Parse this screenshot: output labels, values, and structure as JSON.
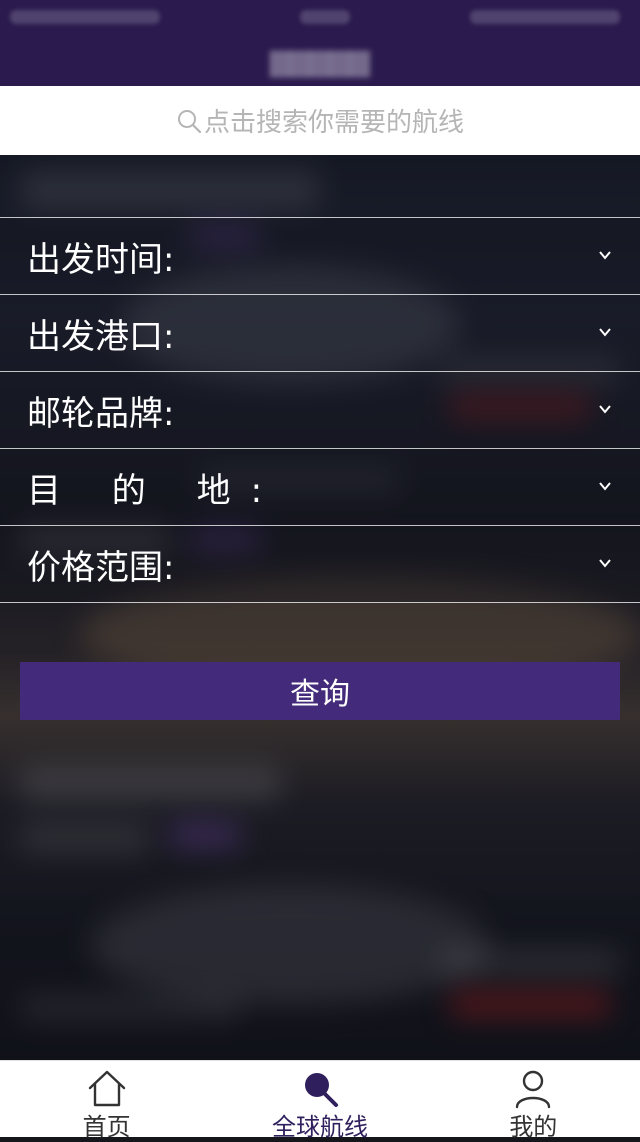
{
  "search": {
    "placeholder": "点击搜索你需要的航线"
  },
  "filters": [
    {
      "label": "出发时间:"
    },
    {
      "label": "出发港口:"
    },
    {
      "label": "邮轮品牌:"
    },
    {
      "label": "目 的 地:"
    },
    {
      "label": "价格范围:"
    }
  ],
  "query_button": "查询",
  "tabbar": {
    "items": [
      {
        "label": "首页",
        "icon": "home-icon",
        "active": false
      },
      {
        "label": "全球航线",
        "icon": "search-icon",
        "active": true
      },
      {
        "label": "我的",
        "icon": "user-icon",
        "active": false
      }
    ]
  },
  "colors": {
    "nav_bg": "#2a1a4e",
    "accent": "#432a7a",
    "active_tab": "#2f1f5c"
  }
}
